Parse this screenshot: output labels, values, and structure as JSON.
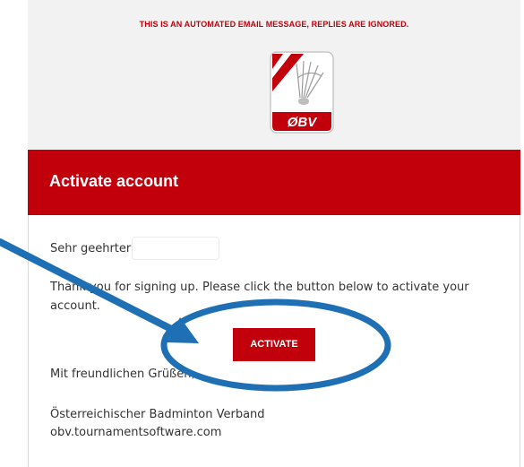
{
  "email": {
    "notice": "THIS IS AN AUTOMATED EMAIL MESSAGE, REPLIES ARE IGNORED.",
    "logo_text": "ØBV",
    "header_title": "Activate account",
    "greeting": "Sehr geehrter",
    "intro": "Thank you for signing up. Please click the button below to activate your account.",
    "activate_label": "ACTIVATE",
    "sign_off": "Mit freundlichen Grüßen,",
    "org_name": "Österreichischer Badminton Verband",
    "org_url": "obv.tournamentsoftware.com"
  },
  "colors": {
    "brand_red": "#c2000b",
    "annotation_blue": "#1f6fb5",
    "email_background": "#f2f2f2"
  },
  "annotations": {
    "arrow_icon": "arrow-icon",
    "highlight_icon": "ellipse-highlight-icon"
  }
}
